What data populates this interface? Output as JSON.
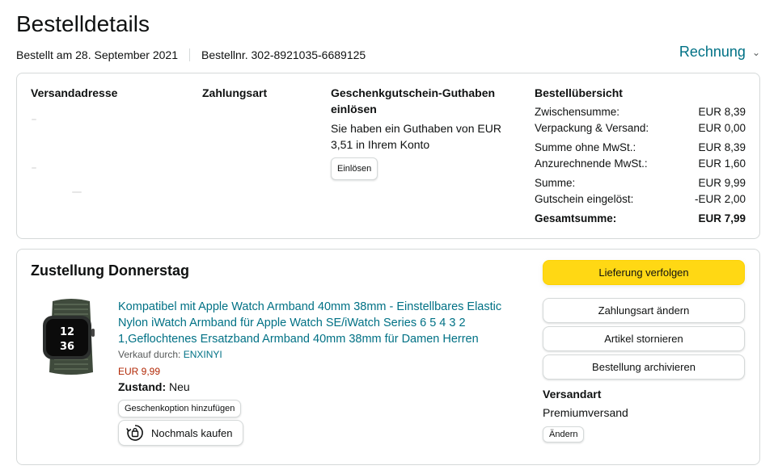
{
  "header": {
    "title": "Bestelldetails",
    "ordered_on": "Bestellt am 28. September 2021",
    "order_number": "Bestellnr. 302-8921035-6689125",
    "invoice_label": "Rechnung"
  },
  "summary_card": {
    "address_heading": "Versandadresse",
    "payment_heading": "Zahlungsart",
    "gift": {
      "heading": "Geschenkgutschein-Guthaben einlösen",
      "text": "Sie haben ein Guthaben von EUR 3,51 in Ihrem Konto",
      "button": "Einlösen"
    },
    "order_overview": {
      "heading": "Bestellübersicht",
      "rows": [
        {
          "label": "Zwischensumme:",
          "value": "EUR 8,39"
        },
        {
          "label": "Verpackung & Versand:",
          "value": "EUR 0,00"
        },
        {
          "label": "Summe ohne MwSt.:",
          "value": "EUR 8,39"
        },
        {
          "label": "Anzurechnende MwSt.:",
          "value": "EUR 1,60"
        },
        {
          "label": "Summe:",
          "value": "EUR 9,99"
        },
        {
          "label": "Gutschein eingelöst:",
          "value": "-EUR 2,00"
        },
        {
          "label": "Gesamtsumme:",
          "value": "EUR 7,99"
        }
      ]
    }
  },
  "delivery_card": {
    "title": "Zustellung Donnerstag",
    "product": {
      "title": "Kompatibel mit Apple Watch Armband 40mm 38mm - Einstellbares Elastic Nylon iWatch Armband für Apple Watch SE/iWatch Series 6 5 4 3 2 1,Geflochtenes Ersatzband Armband 40mm 38mm für Damen Herren",
      "seller_label": "Verkauf durch:",
      "seller_name": "ENXINYI",
      "price": "EUR 9,99",
      "condition_label": "Zustand:",
      "condition_value": "Neu",
      "watch_time_top": "12",
      "watch_time_bottom": "36",
      "gift_option_button": "Geschenkoption hinzufügen",
      "rebuy_button": "Nochmals kaufen"
    },
    "actions": {
      "track": "Lieferung verfolgen",
      "change_payment": "Zahlungsart ändern",
      "cancel": "Artikel stornieren",
      "archive": "Bestellung archivieren"
    },
    "shipping": {
      "heading": "Versandart",
      "value": "Premiumversand",
      "change_button": "Ändern"
    }
  },
  "colors": {
    "link": "#007185",
    "price": "#B12704",
    "primary_button": "#FFD814",
    "border": "#D5D9D9"
  }
}
